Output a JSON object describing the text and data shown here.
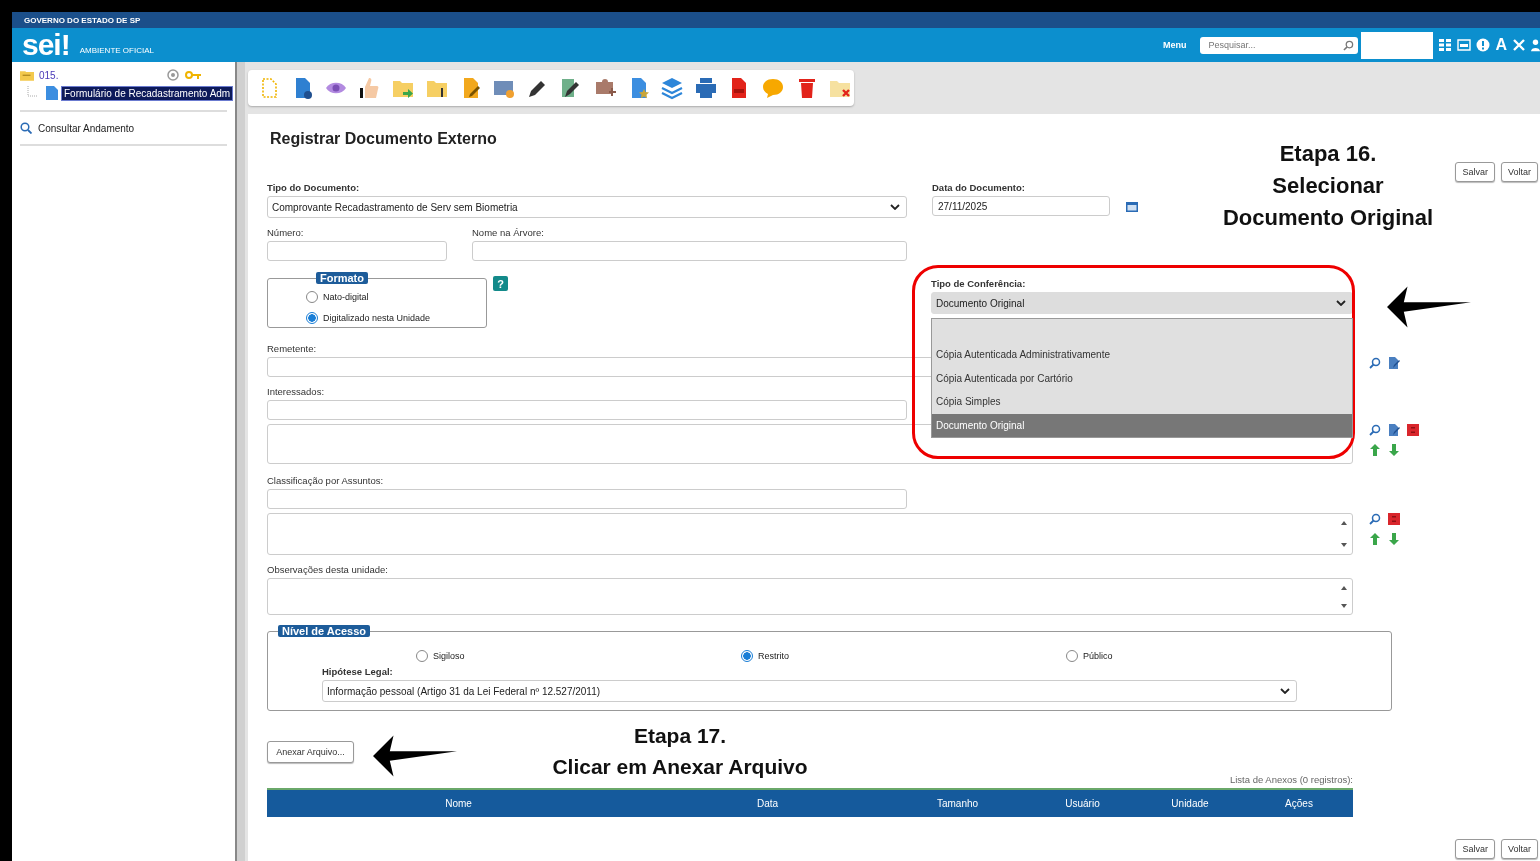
{
  "header": {
    "government": "GOVERNO DO ESTADO DE SP",
    "logo": "sei!",
    "environment": "AMBIENTE OFICIAL",
    "menu": "Menu",
    "search": {
      "placeholder": "Pesquisar..."
    },
    "font_button": "A"
  },
  "sidebar": {
    "process": {
      "number": "015.",
      "children": [
        {
          "label": "Formulário de Recadastramento Adm",
          "selected": true
        }
      ]
    },
    "links": [
      "Consultar Andamento"
    ]
  },
  "page_title": "Registrar Documento Externo",
  "buttons": [
    "Salvar",
    "Voltar"
  ],
  "form": {
    "tipo_documento": {
      "label": "Tipo do Documento:",
      "value": "Comprovante Recadastramento de Serv sem Biometria"
    },
    "data_documento": {
      "label": "Data do Documento:",
      "value": "27/11/2025"
    },
    "numero": {
      "label": "Número:"
    },
    "nome_arvore": {
      "label": "Nome na Árvore:"
    },
    "formato": {
      "legend": "Formato",
      "help": "?",
      "options": [
        {
          "label": "Nato-digital",
          "selected": false
        },
        {
          "label": "Digitalizado nesta Unidade",
          "selected": true
        }
      ]
    },
    "tipo_conferencia": {
      "label": "Tipo de Conferência:",
      "value": "Documento Original",
      "expanded": true,
      "options": [
        {
          "label": "Cópia Autenticada Administrativamente",
          "selected": false
        },
        {
          "label": "Cópia Autenticada por Cartório",
          "selected": false
        },
        {
          "label": "Cópia Simples",
          "selected": false
        },
        {
          "label": "Documento Original",
          "selected": true
        }
      ]
    },
    "remetente": {
      "label": "Remetente:"
    },
    "interessados": {
      "label": "Interessados:"
    },
    "classificacao": {
      "label": "Classificação por Assuntos:"
    },
    "observacoes": {
      "label": "Observações desta unidade:"
    },
    "nivel_acesso": {
      "legend": "Nível de Acesso",
      "options": [
        {
          "label": "Sigiloso",
          "selected": false
        },
        {
          "label": "Restrito",
          "selected": true
        },
        {
          "label": "Público",
          "selected": false
        }
      ],
      "hipotese": {
        "label": "Hipótese Legal:",
        "value": "Informação pessoal (Artigo 31 da Lei Federal nº 12.527/2011)"
      }
    }
  },
  "attach_button": "Anexar Arquivo...",
  "attachments": {
    "caption": "Lista de Anexos (0 registros):",
    "columns": [
      "Nome",
      "Data",
      "Tamanho",
      "Usuário",
      "Unidade",
      "Ações"
    ]
  },
  "bottom_buttons": [
    "Salvar",
    "Voltar"
  ],
  "annotations": [
    {
      "lines": [
        "Etapa 16.",
        "Selecionar",
        "Documento Original"
      ]
    },
    {
      "lines": [
        "Etapa 17.",
        "Clicar em Anexar Arquivo"
      ]
    }
  ]
}
